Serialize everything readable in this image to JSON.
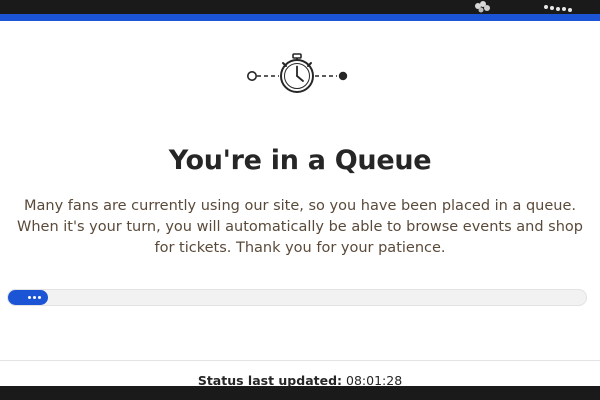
{
  "colors": {
    "accent": "#1c54d6",
    "dark_band": "#1a1a1a",
    "title": "#262626",
    "message": "#5a4a3a"
  },
  "icons": {
    "timer": "stopwatch-icon",
    "start_node": "hollow-circle-icon",
    "end_node": "filled-circle-icon"
  },
  "queue": {
    "title": "You're in a Queue",
    "message": "Many fans are currently using our site, so you have been placed in a queue. When it's your turn, you will automatically be able to browse events and shop for tickets. Thank you for your patience.",
    "progress_fraction": 0.07
  },
  "status": {
    "label": "Status last updated:",
    "time": "08:01:28"
  }
}
